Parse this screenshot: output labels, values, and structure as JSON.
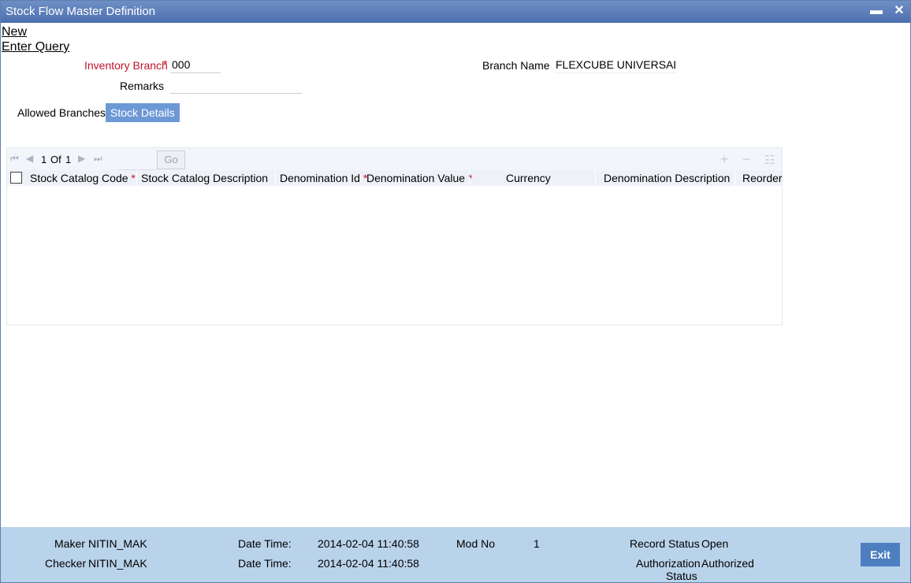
{
  "window": {
    "title": "Stock Flow Master Definition",
    "minimize": "▬",
    "close": "✕"
  },
  "menu": {
    "new": "New",
    "enter_query": "Enter Query"
  },
  "form": {
    "inventory_branch_label": "Inventory Branch",
    "inventory_branch_value": "000",
    "remarks_label": "Remarks",
    "remarks_value": "",
    "branch_name_label": "Branch Name",
    "branch_name_value": "FLEXCUBE UNIVERSAL I",
    "required": "*"
  },
  "tabs": [
    {
      "label": "Allowed Branches",
      "active": false
    },
    {
      "label": "Stock Details",
      "active": true
    }
  ],
  "grid": {
    "pager": {
      "page": "1",
      "of": "Of",
      "total": "1",
      "go": "Go"
    },
    "tools": {
      "add": "+",
      "remove": "−",
      "details": "☷"
    },
    "columns": [
      {
        "label": "Stock Catalog Code",
        "required": true
      },
      {
        "label": "Stock Catalog Description",
        "required": false
      },
      {
        "label": "Denomination Id",
        "required": true
      },
      {
        "label": "Denomination Value",
        "required": true
      },
      {
        "label": "Currency",
        "required": false
      },
      {
        "label": "Denomination Description",
        "required": false
      },
      {
        "label": "Reorder",
        "required": false
      }
    ],
    "rows": []
  },
  "footer": {
    "maker_label": "Maker",
    "maker_value": "NITIN_MAK",
    "checker_label": "Checker",
    "checker_value": "NITIN_MAK",
    "datetime_label": "Date Time:",
    "maker_datetime": "2014-02-04 11:40:58",
    "checker_datetime": "2014-02-04 11:40:58",
    "modno_label": "Mod No",
    "modno_value": "1",
    "record_status_label": "Record Status",
    "record_status_value": "Open",
    "auth_status_label_1": "Authorization",
    "auth_status_label_2": "Status",
    "auth_status_value": "Authorized",
    "exit": "Exit"
  }
}
